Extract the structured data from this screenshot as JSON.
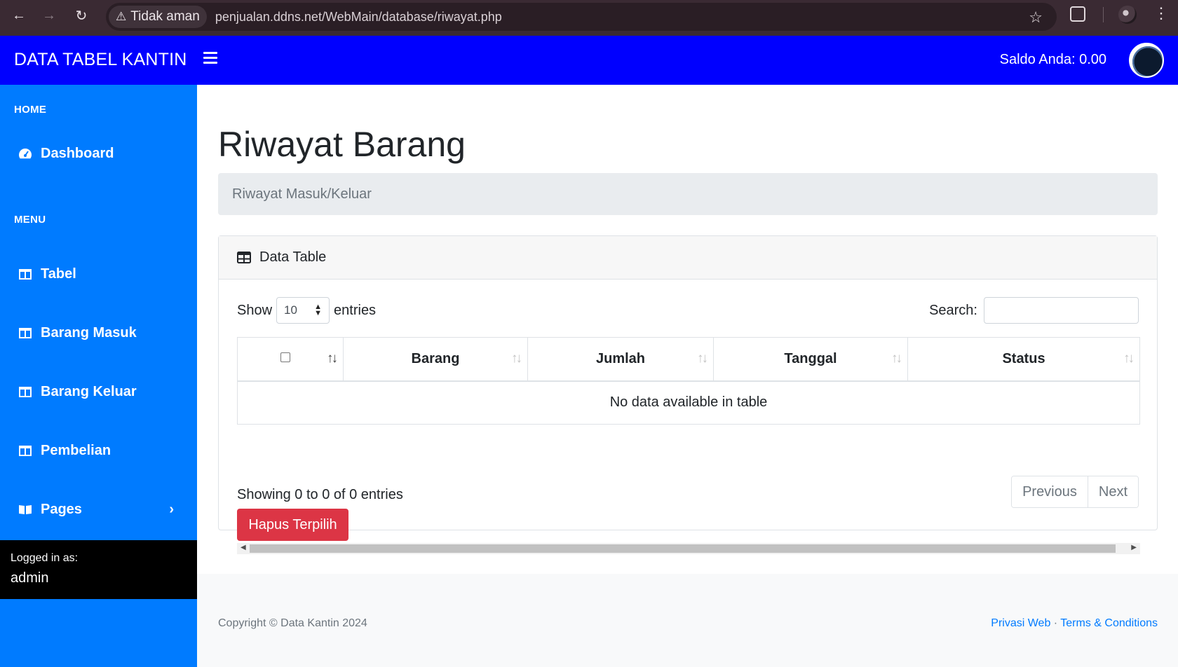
{
  "browser": {
    "security_label": "Tidak aman",
    "url": "penjualan.ddns.net/WebMain/database/riwayat.php"
  },
  "navbar": {
    "brand": "DATA TABEL KANTIN",
    "saldo": "Saldo Anda: 0.00"
  },
  "sidebar": {
    "heading_home": "HOME",
    "heading_menu": "MENU",
    "items": [
      {
        "label": "Dashboard",
        "icon": "tachometer-icon"
      },
      {
        "label": "Tabel",
        "icon": "columns-icon"
      },
      {
        "label": "Barang Masuk",
        "icon": "columns-icon"
      },
      {
        "label": "Barang Keluar",
        "icon": "columns-icon"
      },
      {
        "label": "Pembelian",
        "icon": "columns-icon"
      },
      {
        "label": "Pages",
        "icon": "book-open-icon"
      }
    ],
    "logged_in_label": "Logged in as:",
    "user": "admin"
  },
  "main": {
    "title": "Riwayat Barang",
    "breadcrumb": "Riwayat Masuk/Keluar",
    "card_title": "Data Table",
    "show_label": "Show",
    "entries_value": "10",
    "entries_label": "entries",
    "search_label": "Search:",
    "search_value": "",
    "columns": [
      "",
      "Barang",
      "Jumlah",
      "Tanggal",
      "Status"
    ],
    "empty_message": "No data available in table",
    "info": "Showing 0 to 0 of 0 entries",
    "prev_label": "Previous",
    "next_label": "Next",
    "delete_button": "Hapus Terpilih"
  },
  "footer": {
    "copyright": "Copyright © Data Kantin 2024",
    "privacy": "Privasi Web",
    "separator": "·",
    "terms": "Terms & Conditions"
  },
  "colors": {
    "navbar": "#0000ff",
    "sidebar": "#007bff",
    "danger": "#dc3545"
  }
}
